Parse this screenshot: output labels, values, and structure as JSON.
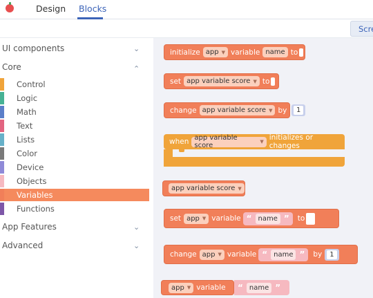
{
  "header": {
    "tabs": [
      {
        "label": "Design"
      },
      {
        "label": "Blocks"
      }
    ],
    "screen_button": "Scre"
  },
  "sidebar": {
    "sections": [
      {
        "label": "UI components",
        "icon": "chevron-down-icon"
      },
      {
        "label": "Core",
        "icon": "chevron-up-icon"
      },
      {
        "label": "App Features",
        "icon": "chevron-down-icon"
      },
      {
        "label": "Advanced",
        "icon": "chevron-down-icon"
      }
    ],
    "core_items": [
      {
        "label": "Control",
        "color": "#f0a43a"
      },
      {
        "label": "Logic",
        "color": "#47b294"
      },
      {
        "label": "Math",
        "color": "#5b7fc9"
      },
      {
        "label": "Text",
        "color": "#e26480"
      },
      {
        "label": "Lists",
        "color": "#67b1c9"
      },
      {
        "label": "Color",
        "color": "#7a7a7a"
      },
      {
        "label": "Device",
        "color": "#8f8ad8"
      },
      {
        "label": "Objects",
        "color": "#f6b9c0"
      },
      {
        "label": "Variables",
        "color": "#f17f59"
      },
      {
        "label": "Functions",
        "color": "#7e57a8"
      }
    ]
  },
  "blocks": {
    "b1": {
      "t1": "initialize",
      "dd1": "app",
      "t2": "variable",
      "name": "name",
      "t3": "to"
    },
    "b2": {
      "t1": "set",
      "dd1": "app variable score",
      "t2": "to"
    },
    "b3": {
      "t1": "change",
      "dd1": "app variable score",
      "t2": "by",
      "num": "1"
    },
    "b4": {
      "t1": "when",
      "dd1": "app variable score",
      "t2": "initializes or changes"
    },
    "b5": {
      "dd1": "app variable score"
    },
    "b6": {
      "t1": "set",
      "dd1": "app",
      "t2": "variable",
      "str": "name",
      "t3": "to"
    },
    "b7": {
      "t1": "change",
      "dd1": "app",
      "t2": "variable",
      "str": "name",
      "t3": "by",
      "num": "1"
    },
    "b8": {
      "dd1": "app",
      "t2": "variable",
      "str": "name"
    },
    "quote_open": "“",
    "quote_close": "”",
    "dropdown_arrow": "▼"
  },
  "colors": {
    "variables": "#f17f59",
    "control": "#f0a43a",
    "objects": "#f6b9c0",
    "accent": "#3b63b8"
  }
}
